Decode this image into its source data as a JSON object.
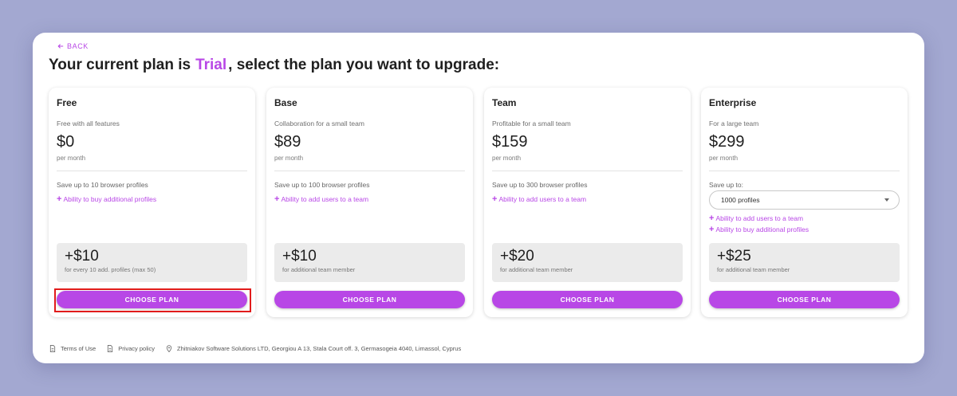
{
  "back_label": "Back",
  "headline": {
    "prefix": "Your current plan is",
    "current_plan": "Trial",
    "suffix": ", select the plan you want to upgrade:"
  },
  "plans": [
    {
      "name": "Free",
      "description": "Free with all features",
      "price": "$0",
      "period": "per month",
      "save_text": "Save up to 10 browser profiles",
      "features": [
        "Ability to buy additional profiles"
      ],
      "addon_price": "+$10",
      "addon_note": "for every 10 add. profiles (max 50)",
      "button": "CHOOSE PLAN"
    },
    {
      "name": "Base",
      "description": "Collaboration for a small team",
      "price": "$89",
      "period": "per month",
      "save_text": "Save up to 100 browser profiles",
      "features": [
        "Ability to add users to a team"
      ],
      "addon_price": "+$10",
      "addon_note": "for additional team member",
      "button": "CHOOSE PLAN"
    },
    {
      "name": "Team",
      "description": "Profitable for a small team",
      "price": "$159",
      "period": "per month",
      "save_text": "Save up to 300 browser profiles",
      "features": [
        "Ability to add users to a team"
      ],
      "addon_price": "+$20",
      "addon_note": "for additional team member",
      "button": "CHOOSE PLAN"
    },
    {
      "name": "Enterprise",
      "description": "For a large team",
      "price": "$299",
      "period": "per month",
      "save_text": "Save up to:",
      "select_value": "1000 profiles",
      "features": [
        "Ability to add users to a team",
        "Ability to buy additional profiles"
      ],
      "addon_price": "+$25",
      "addon_note": "for additional team member",
      "button": "CHOOSE PLAN"
    }
  ],
  "footer": {
    "terms": "Terms of Use",
    "privacy": "Privacy policy",
    "address": "Zhitniakov Software Solutions LTD, Georgiou A 13, Stala Court off. 3, Germasogeia 4040, Limassol, Cyprus"
  },
  "colors": {
    "accent": "#b847e6",
    "background": "#a3a8d1",
    "highlight_border": "#e11b1b"
  }
}
